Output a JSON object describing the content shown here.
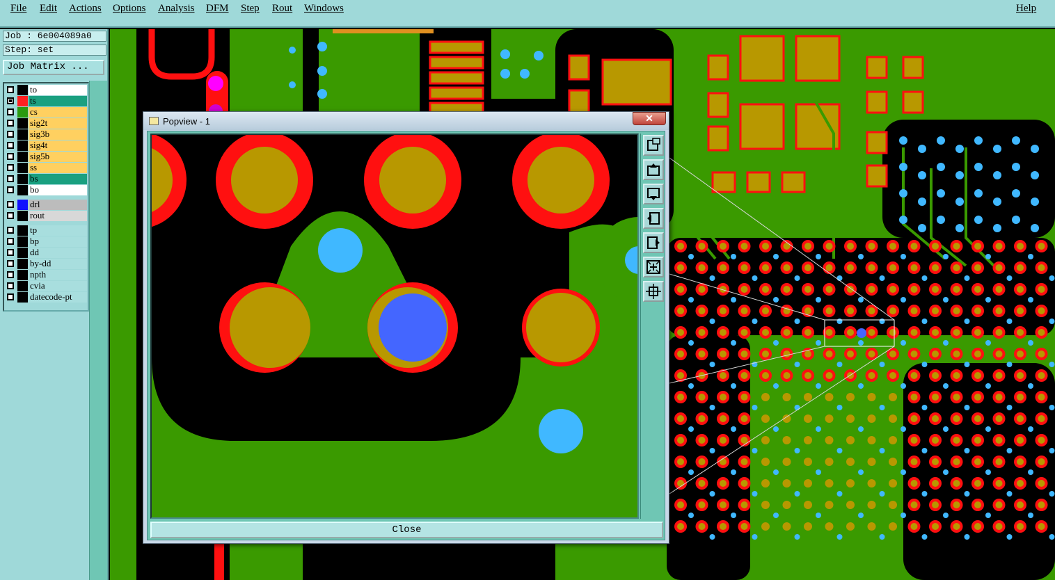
{
  "menubar": {
    "items": [
      "File",
      "Edit",
      "Actions",
      "Options",
      "Analysis",
      "DFM",
      "Step",
      "Rout",
      "Windows"
    ],
    "help": "Help"
  },
  "job": {
    "job_label": "Job : 6e004089a0",
    "step_label": "Step: set",
    "matrix_button": "Job Matrix ..."
  },
  "layers": [
    {
      "name": "to",
      "swatch": "#000000",
      "bg": "#ffffff",
      "checked": false
    },
    {
      "name": "ts",
      "swatch": "#ff2020",
      "bg": "#1aa080",
      "checked": true
    },
    {
      "name": "cs",
      "swatch": "#2a9a10",
      "bg": "#ffd060",
      "checked": false
    },
    {
      "name": "sig2t",
      "swatch": "#000000",
      "bg": "#ffd060",
      "checked": false
    },
    {
      "name": "sig3b",
      "swatch": "#000000",
      "bg": "#ffd060",
      "checked": false
    },
    {
      "name": "sig4t",
      "swatch": "#000000",
      "bg": "#ffd060",
      "checked": false
    },
    {
      "name": "sig5b",
      "swatch": "#000000",
      "bg": "#ffd060",
      "checked": false
    },
    {
      "name": "ss",
      "swatch": "#000000",
      "bg": "#ffd060",
      "checked": false
    },
    {
      "name": "bs",
      "swatch": "#000000",
      "bg": "#1aa080",
      "checked": false
    },
    {
      "name": "bo",
      "swatch": "#000000",
      "bg": "#ffffff",
      "checked": false
    },
    {
      "name": "drl",
      "swatch": "#1010ff",
      "bg": "#bcbcbc",
      "checked": false
    },
    {
      "name": "rout",
      "swatch": "#000000",
      "bg": "#d8d8d8",
      "checked": false
    },
    {
      "name": "tp",
      "swatch": "#000000",
      "bg": "#a8dede",
      "checked": false
    },
    {
      "name": "bp",
      "swatch": "#000000",
      "bg": "#a8dede",
      "checked": false
    },
    {
      "name": "dd",
      "swatch": "#000000",
      "bg": "#a8dede",
      "checked": false
    },
    {
      "name": "by-dd",
      "swatch": "#000000",
      "bg": "#a8dede",
      "checked": false
    },
    {
      "name": "npth",
      "swatch": "#000000",
      "bg": "#a8dede",
      "checked": false
    },
    {
      "name": "cvia",
      "swatch": "#000000",
      "bg": "#a8dede",
      "checked": false
    },
    {
      "name": "datecode-pt",
      "swatch": "#000000",
      "bg": "#a8dede",
      "checked": false
    }
  ],
  "popview": {
    "title": "Popview - 1",
    "close_x": "✕",
    "close_button": "Close",
    "tools": [
      "zoom-fit-icon",
      "pan-up-icon",
      "pan-down-icon",
      "pan-left-icon",
      "pan-right-icon",
      "zoom-out-icon",
      "zoom-in-icon"
    ]
  },
  "colors": {
    "copper": "#3a9a00",
    "pad": "#b89800",
    "pad_ring": "#ff1010",
    "via": "#40b8ff",
    "drill": "#4466ff",
    "background": "#000000",
    "panel": "#9fd9d9",
    "scroll": "#6fc6b4"
  }
}
